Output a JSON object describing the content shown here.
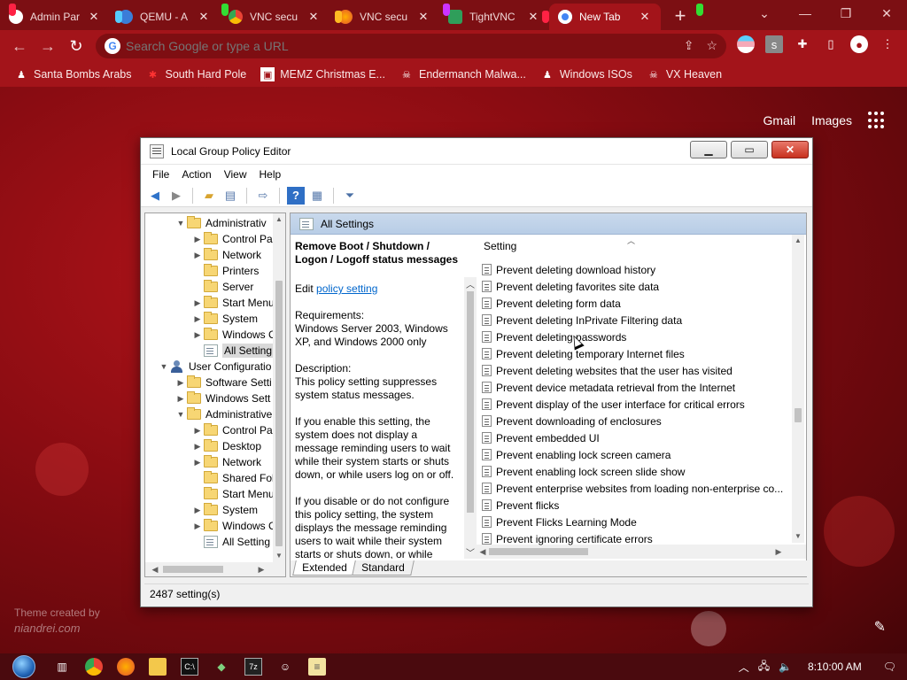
{
  "browser": {
    "tabs": [
      {
        "label": "Admin Par",
        "active": false
      },
      {
        "label": "QEMU - A",
        "active": false
      },
      {
        "label": "VNC secu",
        "active": false
      },
      {
        "label": "VNC secu",
        "active": false
      },
      {
        "label": "TightVNC",
        "active": false
      },
      {
        "label": "New Tab",
        "active": true
      }
    ],
    "new_tab_glyph": "+",
    "omnibox_placeholder": "Search Google or type a URL",
    "bookmarks": [
      {
        "label": "Santa Bombs Arabs",
        "icon": "person-icon"
      },
      {
        "label": "South Hard Pole",
        "icon": "snowflake-icon"
      },
      {
        "label": "MEMZ Christmas E...",
        "icon": "image-icon"
      },
      {
        "label": "Endermanch Malwa...",
        "icon": "skull-icon"
      },
      {
        "label": "Windows ISOs",
        "icon": "person-icon"
      },
      {
        "label": "VX Heaven",
        "icon": "skull-icon"
      }
    ],
    "google_links": {
      "gmail": "Gmail",
      "images": "Images"
    },
    "theme_credit": {
      "line1": "Theme created by",
      "line2": "niandrei.com"
    },
    "accent": "#a3141a"
  },
  "gpedit": {
    "title": "Local Group Policy Editor",
    "menu": [
      "File",
      "Action",
      "View",
      "Help"
    ],
    "tree": [
      {
        "label": "Administrativ",
        "level": 1,
        "arrow": "open",
        "icon": "folder"
      },
      {
        "label": "Control Pa",
        "level": 2,
        "arrow": "closed",
        "icon": "folder"
      },
      {
        "label": "Network",
        "level": 2,
        "arrow": "closed",
        "icon": "folder"
      },
      {
        "label": "Printers",
        "level": 2,
        "arrow": "",
        "icon": "folder"
      },
      {
        "label": "Server",
        "level": 2,
        "arrow": "",
        "icon": "folder"
      },
      {
        "label": "Start Menu",
        "level": 2,
        "arrow": "closed",
        "icon": "folder"
      },
      {
        "label": "System",
        "level": 2,
        "arrow": "closed",
        "icon": "folder"
      },
      {
        "label": "Windows C",
        "level": 2,
        "arrow": "closed",
        "icon": "folder"
      },
      {
        "label": "All Setting",
        "level": 2,
        "arrow": "",
        "icon": "policy",
        "selected": true
      },
      {
        "label": "User Configuratio",
        "level": 0,
        "arrow": "open",
        "icon": "user"
      },
      {
        "label": "Software Setti",
        "level": 1,
        "arrow": "closed",
        "icon": "folder"
      },
      {
        "label": "Windows Sett",
        "level": 1,
        "arrow": "closed",
        "icon": "folder"
      },
      {
        "label": "Administrative",
        "level": 1,
        "arrow": "open",
        "icon": "folder"
      },
      {
        "label": "Control Pa",
        "level": 2,
        "arrow": "closed",
        "icon": "folder"
      },
      {
        "label": "Desktop",
        "level": 2,
        "arrow": "closed",
        "icon": "folder"
      },
      {
        "label": "Network",
        "level": 2,
        "arrow": "closed",
        "icon": "folder"
      },
      {
        "label": "Shared Fol",
        "level": 2,
        "arrow": "",
        "icon": "folder"
      },
      {
        "label": "Start Menu",
        "level": 2,
        "arrow": "",
        "icon": "folder"
      },
      {
        "label": "System",
        "level": 2,
        "arrow": "closed",
        "icon": "folder"
      },
      {
        "label": "Windows C",
        "level": 2,
        "arrow": "closed",
        "icon": "folder"
      },
      {
        "label": "All Setting",
        "level": 2,
        "arrow": "",
        "icon": "policy"
      }
    ],
    "right_header": "All Settings",
    "description": {
      "title": "Remove Boot / Shutdown / Logon / Logoff status messages",
      "edit_prefix": "Edit ",
      "edit_link": "policy setting ",
      "requirements": "Requirements:\nWindows Server 2003, Windows XP, and Windows 2000 only",
      "description": "Description:\nThis policy setting suppresses system status messages.",
      "enable": "If you enable this setting, the system does not display a message reminding users to wait while their system starts or shuts down, or while users log on or off.",
      "disable": "If you disable or do not configure this policy setting, the system displays the message reminding users to wait while their system starts or shuts down, or while"
    },
    "list_header": "Setting",
    "settings": [
      "Prevent deleting download history",
      "Prevent deleting favorites site data",
      "Prevent deleting form data",
      "Prevent deleting InPrivate Filtering data",
      "Prevent deleting passwords",
      "Prevent deleting temporary Internet files",
      "Prevent deleting websites that the user has visited",
      "Prevent device metadata retrieval from the Internet",
      "Prevent display of the user interface for critical errors",
      "Prevent downloading of enclosures",
      "Prevent embedded UI",
      "Prevent enabling lock screen camera",
      "Prevent enabling lock screen slide show",
      "Prevent enterprise websites from loading non-enterprise co...",
      "Prevent flicks",
      "Prevent Flicks Learning Mode",
      "Prevent ignoring certificate errors"
    ],
    "view_tabs": [
      "Extended",
      "Standard"
    ],
    "status": "2487 setting(s)"
  },
  "taskbar": {
    "clock": "8:10:00 AM"
  }
}
